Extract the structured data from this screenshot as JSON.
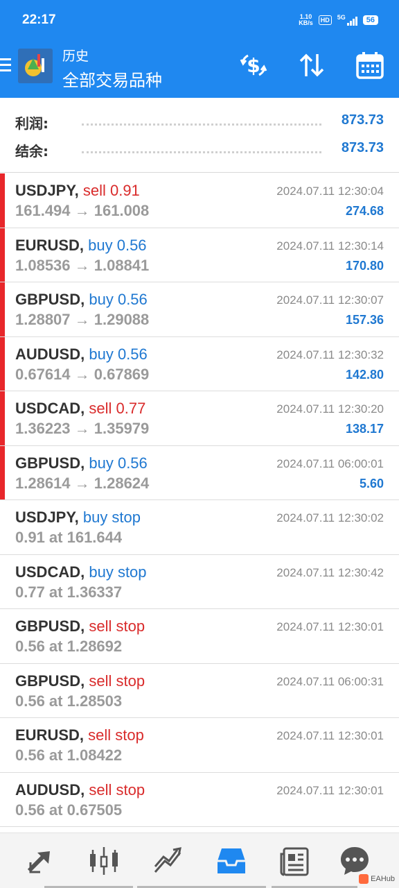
{
  "status": {
    "time": "22:17",
    "netspeed_top": "1.10",
    "netspeed_bottom": "KB/s",
    "hd": "HD",
    "network": "5G",
    "battery": "56"
  },
  "header": {
    "subtitle": "历史",
    "title": "全部交易品种"
  },
  "summary": {
    "profit_label": "利润:",
    "profit_value": "873.73",
    "balance_label": "结余:",
    "balance_value": "873.73"
  },
  "rows": [
    {
      "symbol": "USDJPY,",
      "action": "sell 0.91",
      "detail": "161.494 → 161.008",
      "datetime": "2024.07.11 12:30:04",
      "profit": "274.68"
    },
    {
      "symbol": "EURUSD,",
      "action": "buy 0.56",
      "detail": "1.08536 → 1.08841",
      "datetime": "2024.07.11 12:30:14",
      "profit": "170.80"
    },
    {
      "symbol": "GBPUSD,",
      "action": "buy 0.56",
      "detail": "1.28807 → 1.29088",
      "datetime": "2024.07.11 12:30:07",
      "profit": "157.36"
    },
    {
      "symbol": "AUDUSD,",
      "action": "buy 0.56",
      "detail": "0.67614 → 0.67869",
      "datetime": "2024.07.11 12:30:32",
      "profit": "142.80"
    },
    {
      "symbol": "USDCAD,",
      "action": "sell 0.77",
      "detail": "1.36223 → 1.35979",
      "datetime": "2024.07.11 12:30:20",
      "profit": "138.17"
    },
    {
      "symbol": "GBPUSD,",
      "action": "buy 0.56",
      "detail": "1.28614 → 1.28624",
      "datetime": "2024.07.11 06:00:01",
      "profit": "5.60"
    },
    {
      "symbol": "USDJPY,",
      "action": "buy stop",
      "detail": "0.91 at 161.644",
      "datetime": "2024.07.11 12:30:02",
      "profit": ""
    },
    {
      "symbol": "USDCAD,",
      "action": "buy stop",
      "detail": "0.77 at 1.36337",
      "datetime": "2024.07.11 12:30:42",
      "profit": ""
    },
    {
      "symbol": "GBPUSD,",
      "action": "sell stop",
      "detail": "0.56 at 1.28692",
      "datetime": "2024.07.11 12:30:01",
      "profit": ""
    },
    {
      "symbol": "GBPUSD,",
      "action": "sell stop",
      "detail": "0.56 at 1.28503",
      "datetime": "2024.07.11 06:00:31",
      "profit": ""
    },
    {
      "symbol": "EURUSD,",
      "action": "sell stop",
      "detail": "0.56 at 1.08422",
      "datetime": "2024.07.11 12:30:01",
      "profit": ""
    },
    {
      "symbol": "AUDUSD,",
      "action": "sell stop",
      "detail": "0.56 at 0.67505",
      "datetime": "2024.07.11 12:30:01",
      "profit": ""
    }
  ],
  "nav": [
    "quotes-icon",
    "chart-icon",
    "trade-icon",
    "history-icon",
    "news-icon",
    "chat-icon"
  ],
  "watermark": "EAHub",
  "colors": {
    "header": "#1f88f0",
    "sell": "#d92b2b",
    "buy": "#1f78d1",
    "open_marker": "#e8272b"
  }
}
